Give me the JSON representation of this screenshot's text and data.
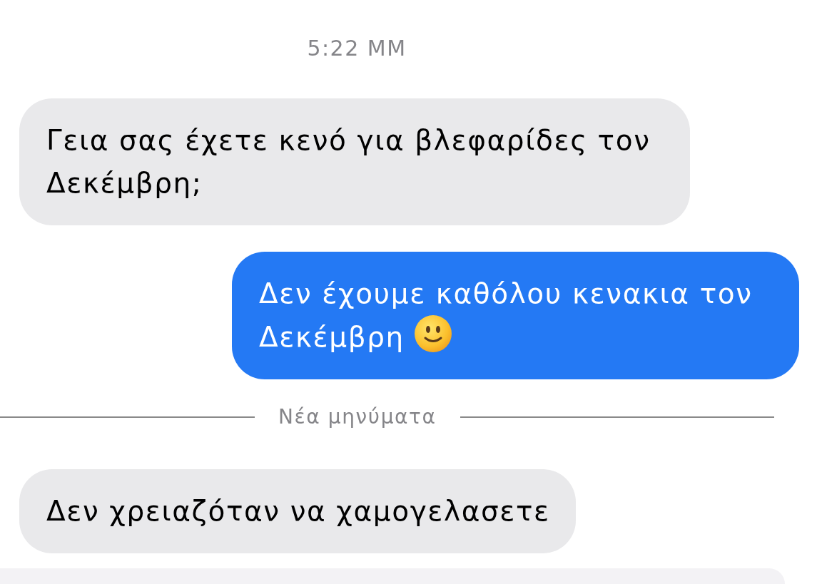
{
  "thread": [
    {
      "kind": "timestamp",
      "text": "5:22 ΜΜ"
    },
    {
      "kind": "incoming",
      "text": "Γεια σας έχετε κενό για βλεφαρίδες τον Δεκέμβρη;"
    },
    {
      "kind": "outgoing",
      "text": "Δεν έχουμε καθόλου κενακια τον Δεκέμβρη",
      "emoji": true
    },
    {
      "kind": "divider",
      "label": "Νέα μηνύματα"
    },
    {
      "kind": "incoming",
      "text": "Δεν χρειαζόταν να χαμογελασετε"
    },
    {
      "kind": "incoming",
      "cut_off": true
    }
  ]
}
